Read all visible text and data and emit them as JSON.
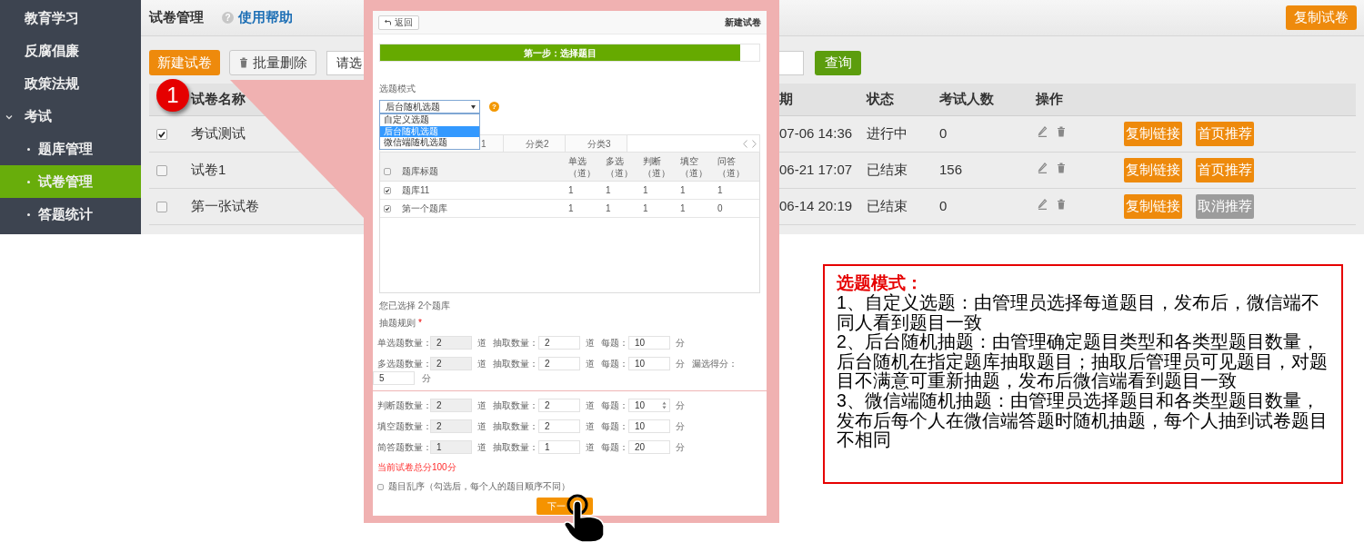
{
  "sidebar": {
    "items": [
      {
        "label": "教育学习",
        "selected": false
      },
      {
        "label": "反腐倡廉",
        "selected": false
      },
      {
        "label": "政策法规",
        "selected": false
      },
      {
        "label": "考试",
        "selected": false,
        "expanded": true,
        "children": [
          {
            "label": "题库管理",
            "selected": false
          },
          {
            "label": "试卷管理",
            "selected": true
          },
          {
            "label": "答题统计",
            "selected": false
          }
        ]
      }
    ]
  },
  "header": {
    "title": "试卷管理",
    "help_icon": "?",
    "help_link": "使用帮助",
    "copy_button": "复制试卷"
  },
  "toolbar": {
    "new_button": "新建试卷",
    "delete_button": "批量删除",
    "filter_select": {
      "value": "请选"
    },
    "search_button": "查询"
  },
  "table": {
    "columns": [
      "试卷名称",
      "期",
      "状态",
      "考试人数",
      "操作"
    ],
    "rows": [
      {
        "checked": true,
        "name": "考试测试",
        "date": "07-06 14:36",
        "status": "进行中",
        "count": "0",
        "actions": [
          {
            "label": "复制链接",
            "kind": "primary"
          },
          {
            "label": "首页推荐",
            "kind": "primary"
          }
        ]
      },
      {
        "checked": false,
        "name": "试卷1",
        "date": "06-21 17:07",
        "status": "已结束",
        "count": "156",
        "actions": [
          {
            "label": "复制链接",
            "kind": "primary"
          },
          {
            "label": "首页推荐",
            "kind": "primary"
          }
        ]
      },
      {
        "checked": false,
        "name": "第一张试卷",
        "date": "06-14 20:19",
        "status": "已结束",
        "count": "0",
        "actions": [
          {
            "label": "复制链接",
            "kind": "primary"
          },
          {
            "label": "取消推荐",
            "kind": "secondary"
          }
        ]
      }
    ]
  },
  "callout_badge": "1",
  "dialog": {
    "back_button": "返回",
    "title": "新建试卷",
    "progress": {
      "label": "第一步：选择题目",
      "level": 0.95
    },
    "mode": {
      "label": "选题模式",
      "value": "后台随机选题",
      "help_icon": "?",
      "options": [
        {
          "label": "自定义选题",
          "selected": false
        },
        {
          "label": "后台随机选题",
          "selected": true
        },
        {
          "label": "微信端随机选题",
          "selected": false
        }
      ]
    },
    "tabs": [
      {
        "label": "1",
        "selected": false
      },
      {
        "label": "分类2",
        "selected": false
      },
      {
        "label": "分类3",
        "selected": false
      }
    ],
    "bank_table": {
      "columns": [
        "题库标题",
        "单选（道）",
        "多选（道）",
        "判断（道）",
        "填空（道）",
        "问答（道）"
      ],
      "header_checked": false,
      "rows": [
        {
          "checked": true,
          "cells": [
            "题库11",
            "1",
            "1",
            "1",
            "1",
            "1"
          ]
        },
        {
          "checked": true,
          "cells": [
            "第一个题库",
            "1",
            "1",
            "1",
            "1",
            "0"
          ]
        }
      ]
    },
    "selected_summary": "您已选择 2个题库",
    "rules_label": "抽题规则",
    "required_mark": "*",
    "rule_groups": [
      [
        {
          "label": "单选题数量：",
          "total": "2",
          "total_unit": "道",
          "draw_label": "抽取数量：",
          "draw": "2",
          "draw_unit": "道",
          "score_label": "每题：",
          "score": "10",
          "score_unit": "分",
          "spinner": false
        },
        {
          "label": "多选题数量：",
          "total": "2",
          "total_unit": "道",
          "draw_label": "抽取数量：",
          "draw": "2",
          "draw_unit": "道",
          "score_label": "每题：",
          "score": "10",
          "score_unit": "分",
          "spinner": false,
          "partial_label": "漏选得分：",
          "partial": "5",
          "partial_unit": "分"
        }
      ],
      [
        {
          "label": "判断题数量：",
          "total": "2",
          "total_unit": "道",
          "draw_label": "抽取数量：",
          "draw": "2",
          "draw_unit": "道",
          "score_label": "每题：",
          "score": "10",
          "score_unit": "分",
          "spinner": true
        },
        {
          "label": "填空题数量：",
          "total": "2",
          "total_unit": "道",
          "draw_label": "抽取数量：",
          "draw": "2",
          "draw_unit": "道",
          "score_label": "每题：",
          "score": "10",
          "score_unit": "分",
          "spinner": false
        },
        {
          "label": "简答题数量：",
          "total": "1",
          "total_unit": "道",
          "draw_label": "抽取数量：",
          "draw": "1",
          "draw_unit": "道",
          "score_label": "每题：",
          "score": "20",
          "score_unit": "分",
          "spinner": false
        }
      ]
    ],
    "total_score": "当前试卷总分100分",
    "shuffle": {
      "label": "题目乱序（勾选后，每个人的题目顺序不同）",
      "checked": false
    },
    "next_button": "下一"
  },
  "note": {
    "title": "选题模式：",
    "paragraphs": [
      "1、自定义选题：由管理员选择每道题目，发布后，微信端不同人看到题目一致",
      "2、后台随机抽题：由管理确定题目类型和各类型题目数量，后台随机在指定题库抽取题目；抽取后管理员可见题目，对题目不满意可重新抽题，发布后微信端看到题目一致",
      "3、微信端随机抽题：由管理员选择题目和各类型题目数量，发布后每个人在微信端答题时随机抽题，每个人抽到试卷题目不相同"
    ]
  }
}
